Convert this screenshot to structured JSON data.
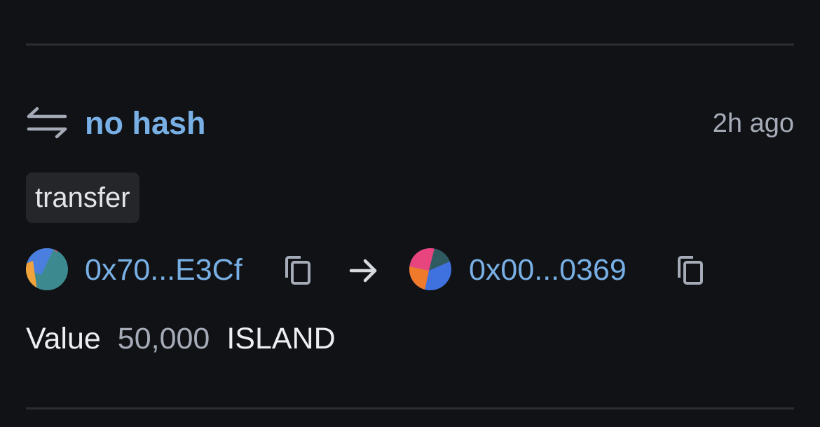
{
  "transaction": {
    "hash_label": "no hash",
    "time_ago": "2h ago",
    "type_tag": "transfer",
    "from": {
      "address": "0x70...E3Cf",
      "avatar_colors": [
        "#3c8a8f",
        "#4a7fe0",
        "#f0a33a",
        "#e04b6a"
      ]
    },
    "to": {
      "address": "0x00...0369",
      "avatar_colors": [
        "#3f72df",
        "#e8447e",
        "#f07a2c",
        "#2f5b60"
      ]
    },
    "value": {
      "label": "Value",
      "amount": "50,000",
      "token": "ISLAND"
    }
  },
  "colors": {
    "background": "#111215",
    "link": "#78b0e6",
    "muted": "#a5acb8",
    "tag_bg": "#24262a",
    "divider": "#2b2d31"
  },
  "icons": {
    "swap": "arrows-left-right-icon",
    "copy": "copy-icon",
    "arrow": "arrow-right-icon"
  }
}
